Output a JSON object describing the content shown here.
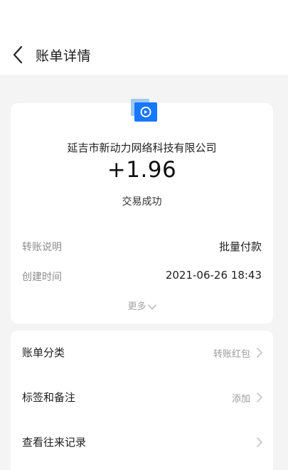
{
  "header": {
    "title": "账单详情",
    "back_icon": "chevron-left-icon"
  },
  "summary": {
    "app_icon": "alipay-transfer-icon",
    "icon_colors": {
      "primary": "#1677ff",
      "secondary": "#9fc8f2"
    },
    "merchant": "延吉市新动力网络科技有限公司",
    "amount": "+1.96",
    "status": "交易成功"
  },
  "details": [
    {
      "label": "转账说明",
      "value": "批量付款"
    },
    {
      "label": "创建时间",
      "value": "2021-06-26 18:43"
    }
  ],
  "more_label": "更多",
  "actions": [
    {
      "label": "账单分类",
      "value": "转账红包"
    },
    {
      "label": "标签和备注",
      "value": "添加"
    },
    {
      "label": "查看往来记录",
      "value": ""
    }
  ]
}
